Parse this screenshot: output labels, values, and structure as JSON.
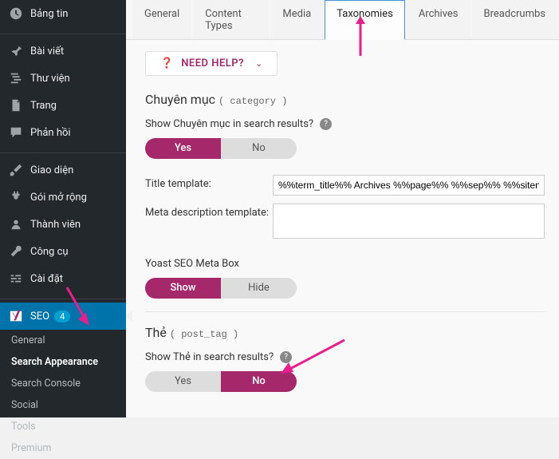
{
  "sidebar": {
    "items": [
      {
        "label": "Bảng tin"
      },
      {
        "label": "Bài viết"
      },
      {
        "label": "Thư viện"
      },
      {
        "label": "Trang"
      },
      {
        "label": "Phản hồi"
      },
      {
        "label": "Giao diện"
      },
      {
        "label": "Gói mở rộng"
      },
      {
        "label": "Thành viên"
      },
      {
        "label": "Công cụ"
      },
      {
        "label": "Cài đặt"
      },
      {
        "label": "SEO",
        "badge": "4"
      }
    ],
    "sub": [
      {
        "label": "General"
      },
      {
        "label": "Search Appearance"
      },
      {
        "label": "Search Console"
      },
      {
        "label": "Social"
      },
      {
        "label": "Tools"
      },
      {
        "label": "Premium"
      }
    ]
  },
  "tabs": [
    {
      "label": "General"
    },
    {
      "label": "Content Types"
    },
    {
      "label": "Media"
    },
    {
      "label": "Taxonomies"
    },
    {
      "label": "Archives"
    },
    {
      "label": "Breadcrumbs"
    }
  ],
  "needHelp": "NEED HELP?",
  "category": {
    "title": "Chuyên mục",
    "slug": "( category )",
    "showLabel": "Show Chuyên mục in search results?",
    "yes": "Yes",
    "no": "No",
    "titleTplLabel": "Title template:",
    "titleTplValue": "%%term_title%% Archives %%page%% %%sep%% %%sitename",
    "metaLabel": "Meta description template:",
    "metaBoxLabel": "Yoast SEO Meta Box",
    "show": "Show",
    "hide": "Hide"
  },
  "tag": {
    "title": "Thẻ",
    "slug": "( post_tag )",
    "showLabel": "Show Thẻ in search results?",
    "yes": "Yes",
    "no": "No"
  }
}
